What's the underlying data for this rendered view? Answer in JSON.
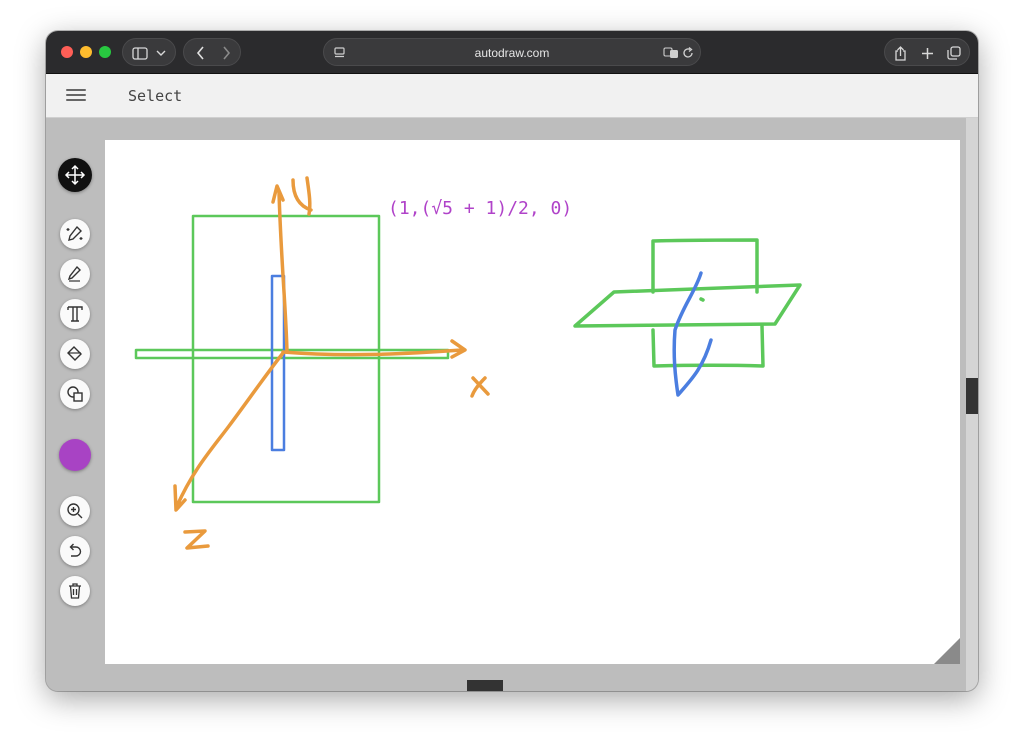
{
  "browser": {
    "url": "autodraw.com"
  },
  "app": {
    "mode_label": "Select"
  },
  "canvas": {
    "annotation": "(1,(√5 + 1)/2, 0)"
  },
  "drawing": {
    "axis_labels": [
      "x",
      "y",
      "z"
    ],
    "stroke_colors": {
      "orange": "#e99a3d",
      "green": "#5cc85a",
      "blue": "#4b7ee0"
    }
  },
  "tools": [
    {
      "name": "move",
      "icon": "move-icon",
      "active": true
    },
    {
      "name": "autodraw",
      "icon": "autodraw-icon"
    },
    {
      "name": "draw",
      "icon": "pencil-icon"
    },
    {
      "name": "type",
      "icon": "text-icon"
    },
    {
      "name": "fill",
      "icon": "fill-bucket-icon"
    },
    {
      "name": "shape",
      "icon": "shapes-icon"
    },
    {
      "name": "color",
      "icon": "color-swatch",
      "color": "#a843c4"
    },
    {
      "name": "zoom",
      "icon": "zoom-in-icon"
    },
    {
      "name": "undo",
      "icon": "undo-icon"
    },
    {
      "name": "delete",
      "icon": "trash-icon"
    }
  ],
  "colors": {
    "current": "#a843c4",
    "annotation": "#b043c9",
    "toolbar_bg": "#2b2b2d"
  }
}
